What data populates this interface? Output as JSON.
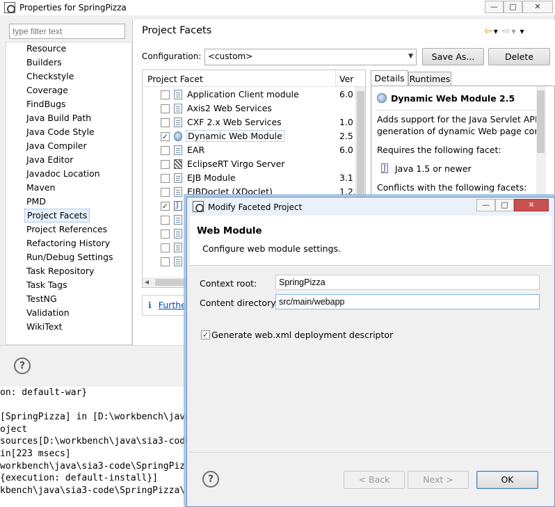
{
  "console": {
    "lines": [
      "on: default-war}",
      "",
      "[SpringPizza] in [D:\\workbench\\java",
      "oject",
      "sources[D:\\workbench\\java\\sia3-code",
      "in[223 msecs]",
      "workbench\\java\\sia3-code\\SpringPiz",
      "{execution: default-install}]",
      "kbench\\java\\sia3-code\\SpringPizza\\"
    ]
  },
  "properties": {
    "title": "Properties for SpringPizza",
    "window_buttons": {
      "minimize": "—",
      "maximize": "□",
      "close": "✕"
    },
    "filter_placeholder": "type filter text",
    "nav_items": [
      "Resource",
      "Builders",
      "Checkstyle",
      "Coverage",
      "FindBugs",
      "Java Build Path",
      "Java Code Style",
      "Java Compiler",
      "Java Editor",
      "Javadoc Location",
      "Maven",
      "PMD",
      "Project Facets",
      "Project References",
      "Refactoring History",
      "Run/Debug Settings",
      "Task Repository",
      "Task Tags",
      "TestNG",
      "Validation",
      "WikiText"
    ],
    "selected_nav": "Project Facets",
    "page_title": "Project Facets",
    "nav_arrows": {
      "back": "⇦",
      "back_menu": "▾",
      "forward": "⇨",
      "forward_menu": "▾",
      "view_menu": "▾"
    },
    "configuration_label": "Configuration:",
    "configuration_value": "<custom>",
    "save_as_label": "Save As...",
    "delete_label": "Delete",
    "facet_table": {
      "col_facet": "Project Facet",
      "col_version": "Ver",
      "rows": [
        {
          "name": "Application Client module",
          "version": "6.0",
          "checked": false,
          "icon": "page"
        },
        {
          "name": "Axis2 Web Services",
          "version": "",
          "checked": false,
          "icon": "page"
        },
        {
          "name": "CXF 2.x Web Services",
          "version": "1.0",
          "checked": false,
          "icon": "page"
        },
        {
          "name": "Dynamic Web Module",
          "version": "2.5",
          "checked": true,
          "icon": "globe"
        },
        {
          "name": "EAR",
          "version": "6.0",
          "checked": false,
          "icon": "page"
        },
        {
          "name": "EclipseRT Virgo Server",
          "version": "",
          "checked": false,
          "icon": "striped"
        },
        {
          "name": "EJB Module",
          "version": "3.1",
          "checked": false,
          "icon": "page"
        },
        {
          "name": "EJBDoclet (XDoclet)",
          "version": "1.2.",
          "checked": false,
          "icon": "page"
        },
        {
          "name": "",
          "version": "",
          "checked": true,
          "icon": "java"
        },
        {
          "name": "",
          "version": "",
          "checked": false,
          "icon": "page"
        },
        {
          "name": "",
          "version": "",
          "checked": false,
          "icon": "page"
        },
        {
          "name": "",
          "version": "",
          "checked": false,
          "icon": "page"
        },
        {
          "name": "",
          "version": "",
          "checked": false,
          "icon": "page"
        }
      ]
    },
    "further_link": "Furthe",
    "details": {
      "tab_details": "Details",
      "tab_runtimes": "Runtimes",
      "title": "Dynamic Web Module 2.5",
      "line1": "Adds support for the Java Servlet API,",
      "line2": "generation of dynamic Web page cont",
      "requires": "Requires the following facet:",
      "required_facet": "Java 1.5 or newer",
      "conflicts": "Conflicts with the following facets:"
    },
    "help_icon": "?"
  },
  "dialog": {
    "title": "Modify Faceted Project",
    "window_buttons": {
      "minimize": "—",
      "maximize": "□",
      "close": "✕"
    },
    "header_title": "Web Module",
    "header_subtitle": "Configure web module settings.",
    "context_root_label": "Context root:",
    "context_root_value": "SpringPizza",
    "content_dir_label": "Content directory:",
    "content_dir_value": "src/main/webapp",
    "generate_label": "Generate web.xml deployment descriptor",
    "generate_checked": true,
    "back_label": "< Back",
    "next_label": "Next >",
    "ok_label": "OK",
    "help_icon": "?"
  }
}
